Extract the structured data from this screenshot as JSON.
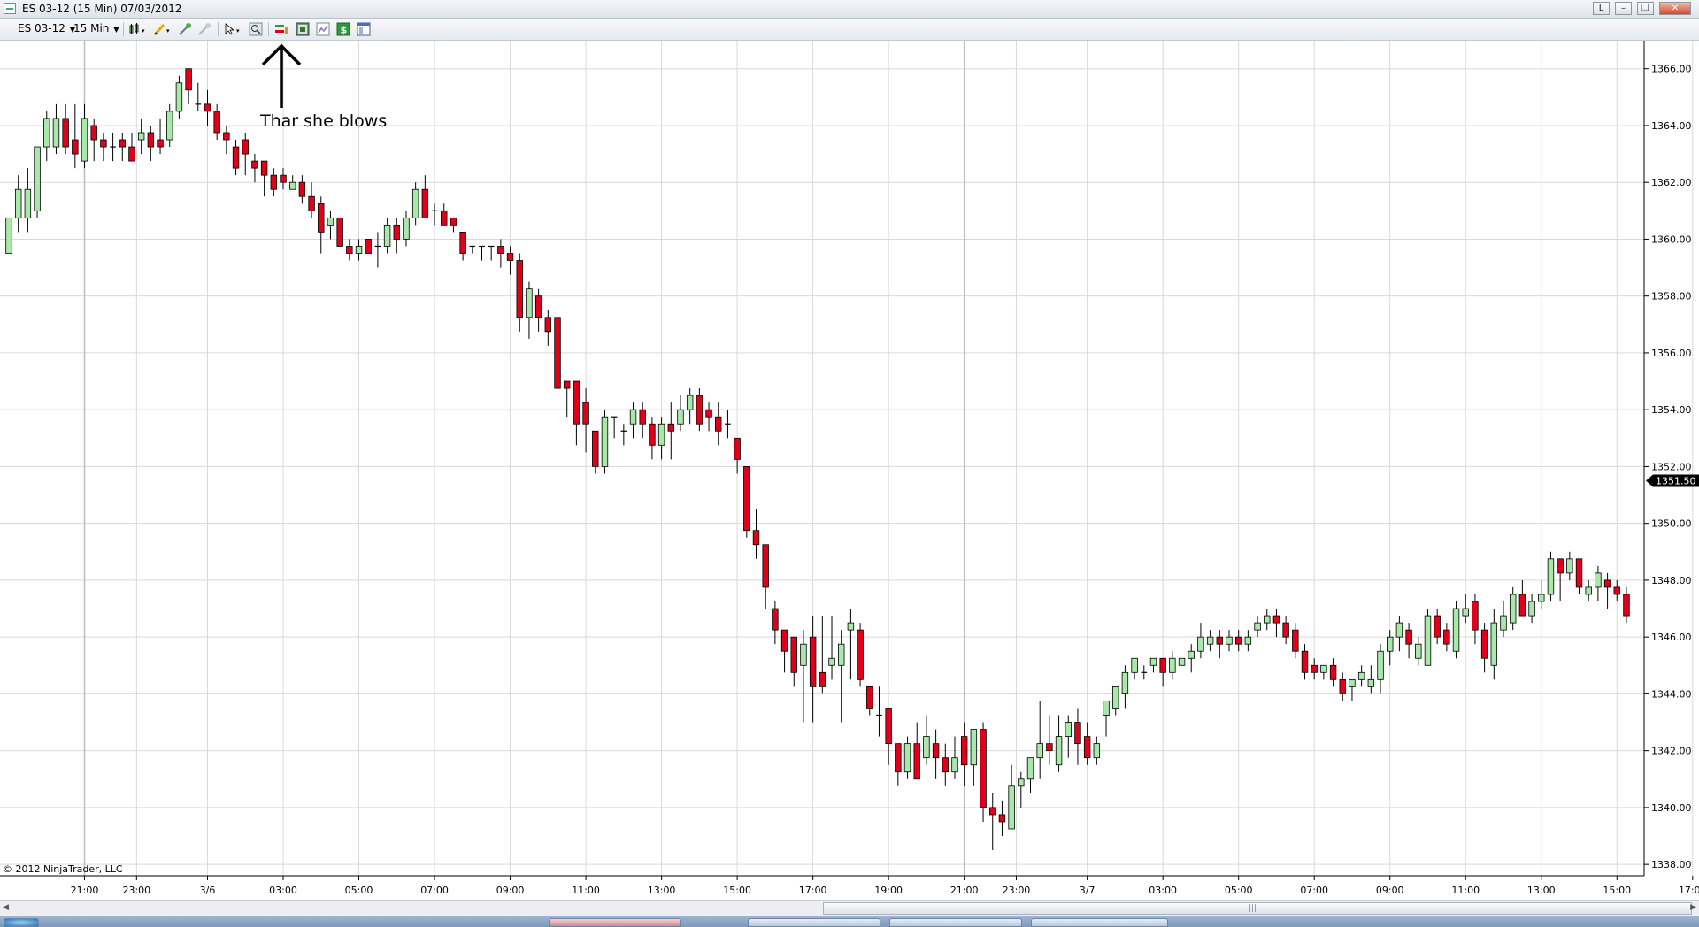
{
  "window": {
    "title": "ES 03-12 (15 Min)  07/03/2012",
    "buttons": [
      "L",
      "–",
      "❐",
      "✕"
    ]
  },
  "toolbar": {
    "instrument": "ES 03-12",
    "interval": "15 Min",
    "icons": [
      "bar-type-icon",
      "pencil-draw-icon",
      "magic-wand-icon",
      "crosshair-pointer-icon",
      "zoom-icon",
      "chart-trader-icon",
      "data-box-icon",
      "properties-icon",
      "dollar-icon",
      "window-layout-icon"
    ]
  },
  "annotation": {
    "text": "Thar she blows"
  },
  "copyright": "© 2012 NinjaTrader, LLC",
  "colors": {
    "up": "#a8e8a8",
    "down": "#e0001a",
    "wick": "#000000",
    "grid": "#d9d9d9",
    "price_marker": "#000000"
  },
  "chart_data": {
    "type": "candlestick",
    "instrument": "ES 03-12",
    "interval": "15 Min",
    "ylim": [
      1337.6,
      1366.8
    ],
    "y_ticks": [
      "1338.00",
      "1340.00",
      "1342.00",
      "1344.00",
      "1346.00",
      "1348.00",
      "1350.00",
      "1352.00",
      "1354.00",
      "1356.00",
      "1358.00",
      "1360.00",
      "1362.00",
      "1364.00",
      "1366.00"
    ],
    "x_ticks": [
      {
        "label": "21:00",
        "index": 8
      },
      {
        "label": "23:00",
        "index": 13.5
      },
      {
        "label": "3/6",
        "index": 21
      },
      {
        "label": "03:00",
        "index": 29
      },
      {
        "label": "05:00",
        "index": 37
      },
      {
        "label": "07:00",
        "index": 45
      },
      {
        "label": "09:00",
        "index": 53
      },
      {
        "label": "11:00",
        "index": 61
      },
      {
        "label": "13:00",
        "index": 69
      },
      {
        "label": "15:00",
        "index": 77
      },
      {
        "label": "17:00",
        "index": 85
      },
      {
        "label": "19:00",
        "index": 93
      },
      {
        "label": "21:00",
        "index": 101
      },
      {
        "label": "23:00",
        "index": 106.5
      },
      {
        "label": "3/7",
        "index": 114
      },
      {
        "label": "03:00",
        "index": 122
      },
      {
        "label": "05:00",
        "index": 130
      },
      {
        "label": "07:00",
        "index": 138
      },
      {
        "label": "09:00",
        "index": 146
      },
      {
        "label": "11:00",
        "index": 154
      },
      {
        "label": "13:00",
        "index": 162
      },
      {
        "label": "15:00",
        "index": 170
      },
      {
        "label": "17:00",
        "index": 178
      }
    ],
    "last_price": "1351.50",
    "candles": [
      {
        "o": 1359.5,
        "h": 1360.5,
        "l": 1359.5,
        "c": 1360.75
      },
      {
        "o": 1360.75,
        "h": 1362.25,
        "l": 1360.25,
        "c": 1361.75
      },
      {
        "o": 1360.75,
        "h": 1362.5,
        "l": 1360.25,
        "c": 1361.75
      },
      {
        "o": 1361,
        "h": 1363.25,
        "l": 1360.75,
        "c": 1363.25
      },
      {
        "o": 1363.25,
        "h": 1364.5,
        "l": 1362.75,
        "c": 1364.25
      },
      {
        "o": 1363.25,
        "h": 1364.75,
        "l": 1363,
        "c": 1364.25
      },
      {
        "o": 1364.25,
        "h": 1364.75,
        "l": 1363,
        "c": 1363.25
      },
      {
        "o": 1363.5,
        "h": 1364.75,
        "l": 1362.5,
        "c": 1363
      },
      {
        "o": 1362.75,
        "h": 1364.75,
        "l": 1362.5,
        "c": 1364.25
      },
      {
        "o": 1364,
        "h": 1364.25,
        "l": 1362.75,
        "c": 1363.5
      },
      {
        "o": 1363.5,
        "h": 1363.75,
        "l": 1362.75,
        "c": 1363.25
      },
      {
        "o": 1363.25,
        "h": 1363.75,
        "l": 1362.75,
        "c": 1363.25
      },
      {
        "o": 1363.5,
        "h": 1363.75,
        "l": 1362.75,
        "c": 1363.25
      },
      {
        "o": 1363.25,
        "h": 1363.75,
        "l": 1362.75,
        "c": 1362.75
      },
      {
        "o": 1363.5,
        "h": 1364.25,
        "l": 1363,
        "c": 1363.75
      },
      {
        "o": 1363.75,
        "h": 1364,
        "l": 1362.75,
        "c": 1363.25
      },
      {
        "o": 1363.5,
        "h": 1364.25,
        "l": 1363,
        "c": 1363.25
      },
      {
        "o": 1363.5,
        "h": 1364.75,
        "l": 1363.25,
        "c": 1364.5
      },
      {
        "o": 1364.5,
        "h": 1365.75,
        "l": 1364.25,
        "c": 1365.5
      },
      {
        "o": 1366,
        "h": 1366,
        "l": 1364.75,
        "c": 1365.25
      },
      {
        "o": 1364.75,
        "h": 1365.5,
        "l": 1364.5,
        "c": 1364.75
      },
      {
        "o": 1364.75,
        "h": 1365.25,
        "l": 1364,
        "c": 1364.5
      },
      {
        "o": 1364.5,
        "h": 1364.75,
        "l": 1363.5,
        "c": 1363.75
      },
      {
        "o": 1363.75,
        "h": 1364,
        "l": 1363,
        "c": 1363.5
      },
      {
        "o": 1363.25,
        "h": 1363.5,
        "l": 1362.25,
        "c": 1362.5
      },
      {
        "o": 1363.5,
        "h": 1363.75,
        "l": 1362.25,
        "c": 1363
      },
      {
        "o": 1362.75,
        "h": 1363,
        "l": 1362,
        "c": 1362.5
      },
      {
        "o": 1362.75,
        "h": 1362.75,
        "l": 1361.5,
        "c": 1362.25
      },
      {
        "o": 1362.25,
        "h": 1362.5,
        "l": 1361.5,
        "c": 1361.75
      },
      {
        "o": 1362.25,
        "h": 1362.5,
        "l": 1361.75,
        "c": 1362
      },
      {
        "o": 1361.75,
        "h": 1362.25,
        "l": 1361.75,
        "c": 1362
      },
      {
        "o": 1362,
        "h": 1362.25,
        "l": 1361.25,
        "c": 1361.5
      },
      {
        "o": 1361.5,
        "h": 1362,
        "l": 1360.75,
        "c": 1361
      },
      {
        "o": 1361.25,
        "h": 1361.5,
        "l": 1359.5,
        "c": 1360.25
      },
      {
        "o": 1360.5,
        "h": 1361,
        "l": 1360,
        "c": 1360.75
      },
      {
        "o": 1360.75,
        "h": 1360.75,
        "l": 1359.75,
        "c": 1359.75
      },
      {
        "o": 1359.75,
        "h": 1360,
        "l": 1359.25,
        "c": 1359.5
      },
      {
        "o": 1359.5,
        "h": 1360,
        "l": 1359.25,
        "c": 1359.75
      },
      {
        "o": 1360,
        "h": 1360,
        "l": 1359.5,
        "c": 1359.5
      },
      {
        "o": 1359.75,
        "h": 1360.25,
        "l": 1359,
        "c": 1359.75
      },
      {
        "o": 1359.75,
        "h": 1360.75,
        "l": 1359.5,
        "c": 1360.5
      },
      {
        "o": 1360.5,
        "h": 1360.75,
        "l": 1359.5,
        "c": 1360
      },
      {
        "o": 1360,
        "h": 1361,
        "l": 1359.75,
        "c": 1360.75
      },
      {
        "o": 1360.75,
        "h": 1362,
        "l": 1360.5,
        "c": 1361.75
      },
      {
        "o": 1361.75,
        "h": 1362.25,
        "l": 1360.75,
        "c": 1360.75
      },
      {
        "o": 1361,
        "h": 1361.25,
        "l": 1360.5,
        "c": 1361
      },
      {
        "o": 1361,
        "h": 1361.25,
        "l": 1360.5,
        "c": 1360.5
      },
      {
        "o": 1360.75,
        "h": 1360.75,
        "l": 1360.25,
        "c": 1360.5
      },
      {
        "o": 1360.25,
        "h": 1360.25,
        "l": 1359.25,
        "c": 1359.5
      },
      {
        "o": 1359.75,
        "h": 1359.75,
        "l": 1359.5,
        "c": 1359.75
      },
      {
        "o": 1359.75,
        "h": 1359.75,
        "l": 1359.25,
        "c": 1359.75
      },
      {
        "o": 1359.75,
        "h": 1359.75,
        "l": 1359.25,
        "c": 1359.75
      },
      {
        "o": 1359.75,
        "h": 1360,
        "l": 1359,
        "c": 1359.5
      },
      {
        "o": 1359.5,
        "h": 1359.75,
        "l": 1358.75,
        "c": 1359.25
      },
      {
        "o": 1359.25,
        "h": 1359.5,
        "l": 1356.75,
        "c": 1357.25
      },
      {
        "o": 1357.25,
        "h": 1358.5,
        "l": 1356.5,
        "c": 1358.25
      },
      {
        "o": 1358,
        "h": 1358.25,
        "l": 1356.75,
        "c": 1357.25
      },
      {
        "o": 1357.25,
        "h": 1357.5,
        "l": 1356.25,
        "c": 1356.75
      },
      {
        "o": 1357.25,
        "h": 1357.25,
        "l": 1354.75,
        "c": 1354.75
      },
      {
        "o": 1355,
        "h": 1355,
        "l": 1353.75,
        "c": 1354.75
      },
      {
        "o": 1355,
        "h": 1355,
        "l": 1352.75,
        "c": 1353.5
      },
      {
        "o": 1354.25,
        "h": 1354.75,
        "l": 1352.5,
        "c": 1353.5
      },
      {
        "o": 1353.25,
        "h": 1353.25,
        "l": 1351.75,
        "c": 1352
      },
      {
        "o": 1352,
        "h": 1354,
        "l": 1351.75,
        "c": 1353.75
      },
      {
        "o": 1353.75,
        "h": 1353.75,
        "l": 1353,
        "c": 1353.75
      },
      {
        "o": 1353.25,
        "h": 1353.5,
        "l": 1352.75,
        "c": 1353.25
      },
      {
        "o": 1353.5,
        "h": 1354.25,
        "l": 1353,
        "c": 1354
      },
      {
        "o": 1354,
        "h": 1354.25,
        "l": 1353,
        "c": 1353.5
      },
      {
        "o": 1353.5,
        "h": 1353.75,
        "l": 1352.25,
        "c": 1352.75
      },
      {
        "o": 1352.75,
        "h": 1353.75,
        "l": 1352.25,
        "c": 1353.5
      },
      {
        "o": 1353.5,
        "h": 1354.25,
        "l": 1352.25,
        "c": 1353.25
      },
      {
        "o": 1353.5,
        "h": 1354.5,
        "l": 1353.25,
        "c": 1354
      },
      {
        "o": 1354,
        "h": 1354.75,
        "l": 1353.5,
        "c": 1354.5
      },
      {
        "o": 1354.5,
        "h": 1354.75,
        "l": 1353.25,
        "c": 1353.5
      },
      {
        "o": 1354,
        "h": 1354.25,
        "l": 1353.25,
        "c": 1353.75
      },
      {
        "o": 1353.75,
        "h": 1354.25,
        "l": 1352.75,
        "c": 1353.25
      },
      {
        "o": 1353.5,
        "h": 1354,
        "l": 1353,
        "c": 1353.5
      },
      {
        "o": 1353,
        "h": 1353,
        "l": 1351.75,
        "c": 1352.25
      },
      {
        "o": 1352,
        "h": 1352,
        "l": 1349.5,
        "c": 1349.75
      },
      {
        "o": 1349.75,
        "h": 1350.5,
        "l": 1348.75,
        "c": 1349.25
      },
      {
        "o": 1349.25,
        "h": 1349.25,
        "l": 1347,
        "c": 1347.75
      },
      {
        "o": 1347,
        "h": 1347.25,
        "l": 1345.75,
        "c": 1346.25
      },
      {
        "o": 1346.25,
        "h": 1346.25,
        "l": 1344.75,
        "c": 1345.5
      },
      {
        "o": 1346,
        "h": 1346,
        "l": 1344.25,
        "c": 1344.75
      },
      {
        "o": 1345,
        "h": 1346.25,
        "l": 1343,
        "c": 1345.75
      },
      {
        "o": 1346,
        "h": 1346.75,
        "l": 1343,
        "c": 1344.25
      },
      {
        "o": 1344.75,
        "h": 1346.75,
        "l": 1344,
        "c": 1344.25
      },
      {
        "o": 1345,
        "h": 1346.75,
        "l": 1344.5,
        "c": 1345.25
      },
      {
        "o": 1345,
        "h": 1346.25,
        "l": 1343,
        "c": 1345.75
      },
      {
        "o": 1346.25,
        "h": 1347,
        "l": 1344.5,
        "c": 1346.5
      },
      {
        "o": 1346.25,
        "h": 1346.5,
        "l": 1344.25,
        "c": 1344.5
      },
      {
        "o": 1344.25,
        "h": 1344.25,
        "l": 1343.25,
        "c": 1343.5
      },
      {
        "o": 1343.25,
        "h": 1344.25,
        "l": 1342.5,
        "c": 1343.25
      },
      {
        "o": 1343.5,
        "h": 1343.5,
        "l": 1341.5,
        "c": 1342.25
      },
      {
        "o": 1342.25,
        "h": 1342.25,
        "l": 1340.75,
        "c": 1341.25
      },
      {
        "o": 1341.25,
        "h": 1342.5,
        "l": 1341,
        "c": 1342.25
      },
      {
        "o": 1342.25,
        "h": 1343,
        "l": 1341,
        "c": 1341
      },
      {
        "o": 1341.75,
        "h": 1343.25,
        "l": 1341.5,
        "c": 1342.5
      },
      {
        "o": 1342.25,
        "h": 1342.75,
        "l": 1341,
        "c": 1341.75
      },
      {
        "o": 1341.75,
        "h": 1342.25,
        "l": 1340.75,
        "c": 1341.25
      },
      {
        "o": 1341.25,
        "h": 1342.5,
        "l": 1341,
        "c": 1341.75
      },
      {
        "o": 1342.5,
        "h": 1343,
        "l": 1340.75,
        "c": 1341.5
      },
      {
        "o": 1341.5,
        "h": 1342.75,
        "l": 1340.75,
        "c": 1342.75
      },
      {
        "o": 1342.75,
        "h": 1343,
        "l": 1339.5,
        "c": 1340
      },
      {
        "o": 1340,
        "h": 1340.5,
        "l": 1338.5,
        "c": 1339.75
      },
      {
        "o": 1339.75,
        "h": 1340.25,
        "l": 1339,
        "c": 1339.5
      },
      {
        "o": 1339.25,
        "h": 1341.5,
        "l": 1339.25,
        "c": 1340.75
      },
      {
        "o": 1340.75,
        "h": 1341.25,
        "l": 1340,
        "c": 1341
      },
      {
        "o": 1341,
        "h": 1341.5,
        "l": 1340.5,
        "c": 1341.75
      },
      {
        "o": 1341.75,
        "h": 1343.75,
        "l": 1341,
        "c": 1342.25
      },
      {
        "o": 1342.25,
        "h": 1343.25,
        "l": 1341.5,
        "c": 1342
      },
      {
        "o": 1341.5,
        "h": 1343.25,
        "l": 1341.25,
        "c": 1342.5
      },
      {
        "o": 1342.5,
        "h": 1343.25,
        "l": 1341.75,
        "c": 1343
      },
      {
        "o": 1343,
        "h": 1343.5,
        "l": 1341.5,
        "c": 1342.25
      },
      {
        "o": 1342.5,
        "h": 1343,
        "l": 1341.5,
        "c": 1341.75
      },
      {
        "o": 1341.75,
        "h": 1342.5,
        "l": 1341.5,
        "c": 1342.25
      },
      {
        "o": 1343.25,
        "h": 1343.75,
        "l": 1342.5,
        "c": 1343.75
      },
      {
        "o": 1343.5,
        "h": 1344.25,
        "l": 1343.25,
        "c": 1344.25
      },
      {
        "o": 1344,
        "h": 1345,
        "l": 1343.5,
        "c": 1344.75
      },
      {
        "o": 1344.75,
        "h": 1345.25,
        "l": 1344.5,
        "c": 1345.25
      },
      {
        "o": 1344.75,
        "h": 1345,
        "l": 1344.5,
        "c": 1344.75
      },
      {
        "o": 1345,
        "h": 1345.25,
        "l": 1344.75,
        "c": 1345.25
      },
      {
        "o": 1345.25,
        "h": 1345.25,
        "l": 1344.25,
        "c": 1344.75
      },
      {
        "o": 1344.75,
        "h": 1345.5,
        "l": 1344.5,
        "c": 1345.25
      },
      {
        "o": 1345,
        "h": 1345.25,
        "l": 1345,
        "c": 1345.25
      },
      {
        "o": 1345.25,
        "h": 1345.75,
        "l": 1344.75,
        "c": 1345.5
      },
      {
        "o": 1345.5,
        "h": 1346.5,
        "l": 1345.25,
        "c": 1346
      },
      {
        "o": 1345.75,
        "h": 1346.25,
        "l": 1345.5,
        "c": 1346
      },
      {
        "o": 1346,
        "h": 1346.25,
        "l": 1345.25,
        "c": 1345.75
      },
      {
        "o": 1345.75,
        "h": 1346.25,
        "l": 1345.5,
        "c": 1346
      },
      {
        "o": 1346,
        "h": 1346.25,
        "l": 1345.5,
        "c": 1345.75
      },
      {
        "o": 1345.75,
        "h": 1346.25,
        "l": 1345.5,
        "c": 1346
      },
      {
        "o": 1346.25,
        "h": 1346.75,
        "l": 1346,
        "c": 1346.5
      },
      {
        "o": 1346.5,
        "h": 1347,
        "l": 1346.25,
        "c": 1346.75
      },
      {
        "o": 1346.75,
        "h": 1347,
        "l": 1346,
        "c": 1346.5
      },
      {
        "o": 1346.5,
        "h": 1346.75,
        "l": 1345.75,
        "c": 1346
      },
      {
        "o": 1346.25,
        "h": 1346.5,
        "l": 1345.25,
        "c": 1345.5
      },
      {
        "o": 1345.5,
        "h": 1345.75,
        "l": 1344.5,
        "c": 1344.75
      },
      {
        "o": 1345,
        "h": 1345.25,
        "l": 1344.5,
        "c": 1344.75
      },
      {
        "o": 1344.75,
        "h": 1345,
        "l": 1344.5,
        "c": 1345
      },
      {
        "o": 1345,
        "h": 1345.25,
        "l": 1344.25,
        "c": 1344.5
      },
      {
        "o": 1344.5,
        "h": 1344.75,
        "l": 1343.75,
        "c": 1344
      },
      {
        "o": 1344.25,
        "h": 1344.5,
        "l": 1343.75,
        "c": 1344.5
      },
      {
        "o": 1344.5,
        "h": 1345,
        "l": 1344.25,
        "c": 1344.75
      },
      {
        "o": 1344.25,
        "h": 1345,
        "l": 1344,
        "c": 1344.5
      },
      {
        "o": 1344.5,
        "h": 1345.75,
        "l": 1344,
        "c": 1345.5
      },
      {
        "o": 1345.5,
        "h": 1346.25,
        "l": 1345,
        "c": 1346
      },
      {
        "o": 1346,
        "h": 1346.75,
        "l": 1345.5,
        "c": 1346.5
      },
      {
        "o": 1346.25,
        "h": 1346.5,
        "l": 1345.25,
        "c": 1345.75
      },
      {
        "o": 1345.25,
        "h": 1346,
        "l": 1345,
        "c": 1345.75
      },
      {
        "o": 1345,
        "h": 1347,
        "l": 1345,
        "c": 1346.75
      },
      {
        "o": 1346.75,
        "h": 1347,
        "l": 1345.75,
        "c": 1346
      },
      {
        "o": 1346.25,
        "h": 1346.5,
        "l": 1345.5,
        "c": 1345.75
      },
      {
        "o": 1345.5,
        "h": 1347.25,
        "l": 1345.25,
        "c": 1347
      },
      {
        "o": 1346.75,
        "h": 1347.5,
        "l": 1346.5,
        "c": 1347
      },
      {
        "o": 1347.25,
        "h": 1347.5,
        "l": 1345.75,
        "c": 1346.25
      },
      {
        "o": 1346.25,
        "h": 1346.5,
        "l": 1344.75,
        "c": 1345.25
      },
      {
        "o": 1345,
        "h": 1347,
        "l": 1344.5,
        "c": 1346.5
      },
      {
        "o": 1346.25,
        "h": 1347.25,
        "l": 1346,
        "c": 1346.75
      },
      {
        "o": 1346.5,
        "h": 1347.75,
        "l": 1346.25,
        "c": 1347.5
      },
      {
        "o": 1347.5,
        "h": 1348,
        "l": 1347,
        "c": 1346.75
      },
      {
        "o": 1346.75,
        "h": 1347.5,
        "l": 1346.5,
        "c": 1347.25
      },
      {
        "o": 1347.25,
        "h": 1348,
        "l": 1347,
        "c": 1347.5
      },
      {
        "o": 1347.5,
        "h": 1349,
        "l": 1347.25,
        "c": 1348.75
      },
      {
        "o": 1348.75,
        "h": 1348.75,
        "l": 1347.25,
        "c": 1348.25
      },
      {
        "o": 1348.25,
        "h": 1349,
        "l": 1348,
        "c": 1348.75
      },
      {
        "o": 1348.75,
        "h": 1348.75,
        "l": 1347.5,
        "c": 1347.75
      },
      {
        "o": 1347.5,
        "h": 1348,
        "l": 1347.25,
        "c": 1347.75
      },
      {
        "o": 1347.75,
        "h": 1348.5,
        "l": 1347.25,
        "c": 1348.25
      },
      {
        "o": 1348,
        "h": 1348.25,
        "l": 1347,
        "c": 1347.75
      },
      {
        "o": 1347.75,
        "h": 1348,
        "l": 1347.25,
        "c": 1347.5
      },
      {
        "o": 1347.5,
        "h": 1347.75,
        "l": 1346.5,
        "c": 1346.75
      }
    ]
  }
}
